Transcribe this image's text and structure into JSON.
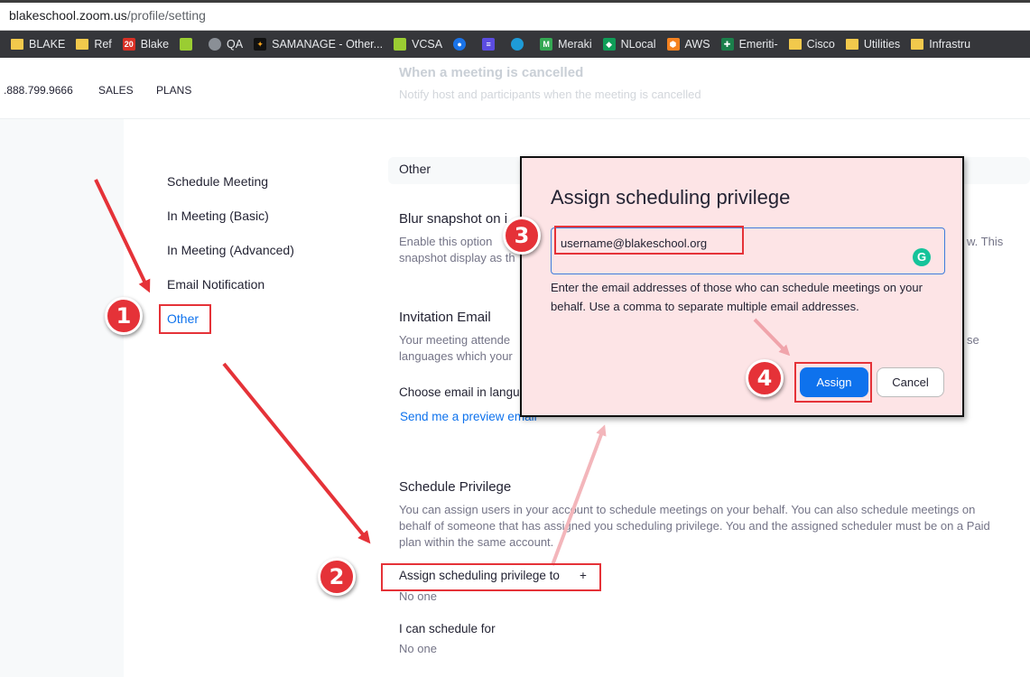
{
  "browser": {
    "url_host": "blakeschool.zoom.us",
    "url_path": "/profile/setting",
    "bookmarks": [
      {
        "label": "BLAKE",
        "icon": "folder-icon",
        "style": "folder"
      },
      {
        "label": "Ref",
        "icon": "folder-icon",
        "style": "folder"
      },
      {
        "label": "Blake",
        "icon": "calendar-icon",
        "style": "red"
      },
      {
        "label": "",
        "icon": "paw-icon",
        "style": "lime"
      },
      {
        "label": "QA",
        "icon": "globe-icon",
        "style": "gray"
      },
      {
        "label": "SAMANAGE - Other...",
        "icon": "samanage-icon",
        "style": "black"
      },
      {
        "label": "VCSA",
        "icon": "vcsa-icon",
        "style": "lime"
      },
      {
        "label": "",
        "icon": "person-icon",
        "style": "blue"
      },
      {
        "label": "",
        "icon": "list-icon",
        "style": "purple"
      },
      {
        "label": "",
        "icon": "drop-icon",
        "style": "teal"
      },
      {
        "label": "Meraki",
        "icon": "meraki-icon",
        "style": "green"
      },
      {
        "label": "NLocal",
        "icon": "nlocal-icon",
        "style": "green2"
      },
      {
        "label": "AWS",
        "icon": "aws-icon",
        "style": "orange"
      },
      {
        "label": "Emeriti-",
        "icon": "cross-icon",
        "style": "dgreen"
      },
      {
        "label": "Cisco",
        "icon": "folder-icon",
        "style": "folder"
      },
      {
        "label": "Utilities",
        "icon": "folder-icon",
        "style": "folder"
      },
      {
        "label": "Infrastru",
        "icon": "folder-icon",
        "style": "folder"
      }
    ]
  },
  "header": {
    "phone": ".888.799.9666",
    "sales": "SALES",
    "plans": "PLANS",
    "faded_title": "When a meeting is cancelled",
    "faded_desc": "Notify host and participants when the meeting is cancelled"
  },
  "nav": {
    "items": [
      "Schedule Meeting",
      "In Meeting (Basic)",
      "In Meeting (Advanced)",
      "Email Notification",
      "Other"
    ],
    "active": "Other"
  },
  "main": {
    "section": "Other",
    "blur": {
      "title": "Blur snapshot on i",
      "desc1": "Enable this option",
      "desc2": "snapshot display as th",
      "desc_right": "w. This"
    },
    "invitation": {
      "title": "Invitation Email",
      "desc1": "Your meeting attende",
      "desc2": "languages which your",
      "desc_right": "se",
      "choose": "Choose email in langu",
      "preview_link": "Send me a preview email"
    },
    "schedule_privilege": {
      "title": "Schedule Privilege",
      "desc1": "You can assign users in your account to schedule meetings on your behalf. You can also schedule meetings on",
      "desc2": "behalf of someone that has assigned you scheduling privilege. You and the assigned scheduler must be on a Paid",
      "desc3": "plan within the same account.",
      "assign_label": "Assign scheduling privilege to",
      "plus": "+",
      "assign_value": "No one",
      "can_schedule_label": "I can schedule for",
      "can_schedule_value": "No one"
    }
  },
  "modal": {
    "title": "Assign scheduling privilege",
    "input_value": "username@blakeschool.org",
    "help": "Enter the email addresses of those who can schedule meetings on your behalf. Use a comma to separate multiple email addresses.",
    "assign_button": "Assign",
    "cancel_button": "Cancel"
  },
  "annotations": {
    "badges": [
      "1",
      "2",
      "3",
      "4"
    ],
    "color": "#e53238"
  }
}
